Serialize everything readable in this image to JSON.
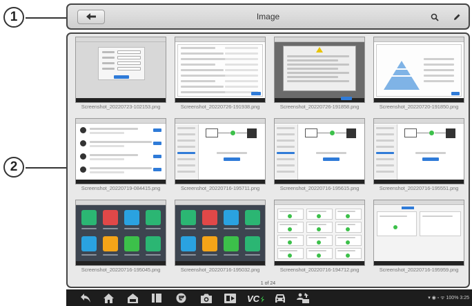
{
  "callouts": [
    "1",
    "2"
  ],
  "header": {
    "title": "Image"
  },
  "thumbnails": [
    {
      "caption": "Screenshot_20220723-102153.png",
      "style": "login"
    },
    {
      "caption": "Screenshot_20220726-191938.png",
      "style": "settings"
    },
    {
      "caption": "Screenshot_20220726-191858.png",
      "style": "dialog-dark"
    },
    {
      "caption": "Screenshot_20220720-191850.png",
      "style": "pyramid"
    },
    {
      "caption": "Screenshot_20220719-084415.png",
      "style": "list"
    },
    {
      "caption": "Screenshot_20220716-195711.png",
      "style": "connect"
    },
    {
      "caption": "Screenshot_20220716-195615.png",
      "style": "connect"
    },
    {
      "caption": "Screenshot_20220716-195551.png",
      "style": "connect"
    },
    {
      "caption": "Screenshot_20220716-195045.png",
      "style": "home"
    },
    {
      "caption": "Screenshot_20220716-195032.png",
      "style": "home"
    },
    {
      "caption": "Screenshot_20220716-194712.png",
      "style": "cards"
    },
    {
      "caption": "Screenshot_20220716-195959.png",
      "style": "panel"
    }
  ],
  "pagination": "1 of 24",
  "status_bar": "100% 3:25",
  "colors": {
    "accent": "#2f7bd8",
    "nav_bg": "#1d1d1d",
    "frame": "#444444"
  }
}
